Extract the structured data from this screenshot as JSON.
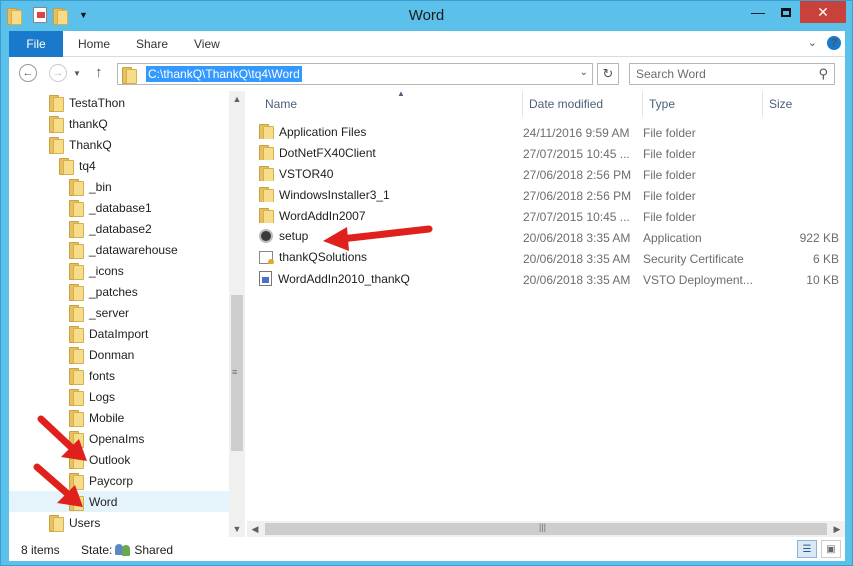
{
  "window": {
    "title": "Word"
  },
  "ribbon": {
    "tabs": [
      {
        "label": "File"
      },
      {
        "label": "Home"
      },
      {
        "label": "Share"
      },
      {
        "label": "View"
      }
    ]
  },
  "address": {
    "path": "C:\\thankQ\\ThankQ\\tq4\\Word"
  },
  "search": {
    "placeholder": "Search Word"
  },
  "tree": {
    "items": [
      {
        "label": "TestaThon",
        "level": 0
      },
      {
        "label": "thankQ",
        "level": 0
      },
      {
        "label": "ThankQ",
        "level": 1
      },
      {
        "label": "tq4",
        "level": 2
      },
      {
        "label": "_bin",
        "level": 3
      },
      {
        "label": "_database1",
        "level": 3
      },
      {
        "label": "_database2",
        "level": 3
      },
      {
        "label": "_datawarehouse",
        "level": 3
      },
      {
        "label": "_icons",
        "level": 3
      },
      {
        "label": "_patches",
        "level": 3
      },
      {
        "label": "_server",
        "level": 3
      },
      {
        "label": "DataImport",
        "level": 3
      },
      {
        "label": "Donman",
        "level": 3
      },
      {
        "label": "fonts",
        "level": 3
      },
      {
        "label": "Logs",
        "level": 3
      },
      {
        "label": "Mobile",
        "level": 3
      },
      {
        "label": "OpenaIms",
        "level": 3
      },
      {
        "label": "Outlook",
        "level": 3
      },
      {
        "label": "Paycorp",
        "level": 3
      },
      {
        "label": "Word",
        "level": 3,
        "selected": true
      },
      {
        "label": "Users",
        "level": 0
      }
    ]
  },
  "columns": {
    "name": "Name",
    "date": "Date modified",
    "type": "Type",
    "size": "Size"
  },
  "files": [
    {
      "name": "Application Files",
      "date": "24/11/2016 9:59 AM",
      "type": "File folder",
      "size": "",
      "icon": "folder-icon"
    },
    {
      "name": "DotNetFX40Client",
      "date": "27/07/2015 10:45 ...",
      "type": "File folder",
      "size": "",
      "icon": "folder-icon"
    },
    {
      "name": "VSTOR40",
      "date": "27/06/2018 2:56 PM",
      "type": "File folder",
      "size": "",
      "icon": "folder-icon"
    },
    {
      "name": "WindowsInstaller3_1",
      "date": "27/06/2018 2:56 PM",
      "type": "File folder",
      "size": "",
      "icon": "folder-icon"
    },
    {
      "name": "WordAddIn2007",
      "date": "27/07/2015 10:45 ...",
      "type": "File folder",
      "size": "",
      "icon": "folder-icon"
    },
    {
      "name": "setup",
      "date": "20/06/2018 3:35 AM",
      "type": "Application",
      "size": "922 KB",
      "icon": "setup-icon"
    },
    {
      "name": "thankQSolutions",
      "date": "20/06/2018 3:35 AM",
      "type": "Security Certificate",
      "size": "6 KB",
      "icon": "certificate-icon"
    },
    {
      "name": "WordAddIn2010_thankQ",
      "date": "20/06/2018 3:35 AM",
      "type": "VSTO Deployment...",
      "size": "10 KB",
      "icon": "vsto-icon"
    }
  ],
  "status": {
    "count": "8 items",
    "state_label": "State:",
    "state_value": "Shared"
  },
  "colors": {
    "titlebar": "#5bc0ea",
    "file_tab": "#1979ca",
    "close": "#c8413a",
    "arrow": "#e0201c"
  }
}
